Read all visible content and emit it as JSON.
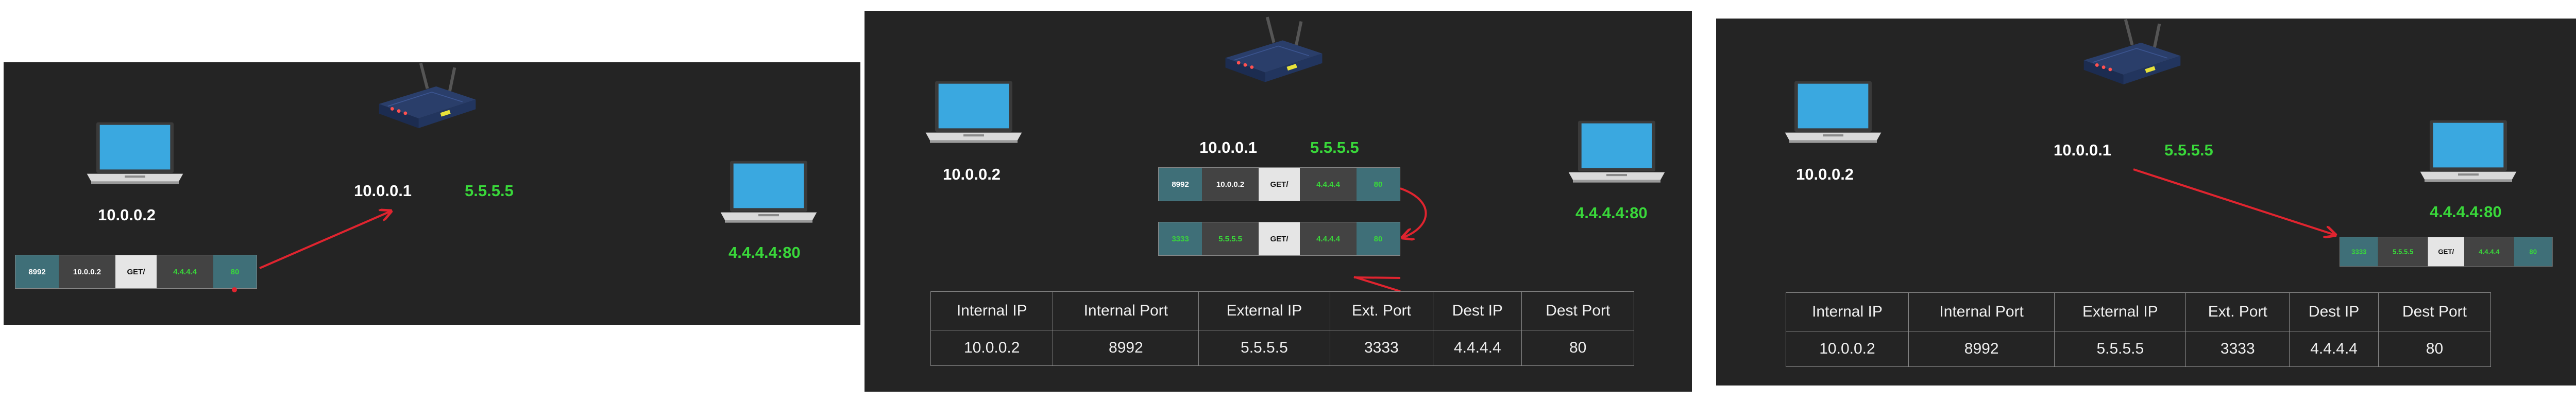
{
  "slides": [
    {
      "host_ip": "10.0.0.2",
      "router_private_ip": "10.0.0.1",
      "router_public_ip": "5.5.5.5",
      "server_addr": "4.4.4.4:80",
      "packet": {
        "src_port": "8992",
        "src_ip": "10.0.0.2",
        "payload": "GET/",
        "dst_ip": "4.4.4.4",
        "dst_port": "80"
      }
    },
    {
      "host_ip": "10.0.0.2",
      "router_private_ip": "10.0.0.1",
      "router_public_ip": "5.5.5.5",
      "server_addr": "4.4.4.4:80",
      "packet_in": {
        "src_port": "8992",
        "src_ip": "10.0.0.2",
        "payload": "GET/",
        "dst_ip": "4.4.4.4",
        "dst_port": "80"
      },
      "packet_out": {
        "src_port": "3333",
        "src_ip": "5.5.5.5",
        "payload": "GET/",
        "dst_ip": "4.4.4.4",
        "dst_port": "80"
      },
      "nat_table": {
        "headers": [
          "Internal IP",
          "Internal Port",
          "External IP",
          "Ext. Port",
          "Dest IP",
          "Dest Port"
        ],
        "row": [
          "10.0.0.2",
          "8992",
          "5.5.5.5",
          "3333",
          "4.4.4.4",
          "80"
        ]
      }
    },
    {
      "host_ip": "10.0.0.2",
      "router_private_ip": "10.0.0.1",
      "router_public_ip": "5.5.5.5",
      "server_addr": "4.4.4.4:80",
      "packet": {
        "src_port": "3333",
        "src_ip": "5.5.5.5",
        "payload": "GET/",
        "dst_ip": "4.4.4.4",
        "dst_port": "80"
      },
      "nat_table": {
        "headers": [
          "Internal IP",
          "Internal Port",
          "External IP",
          "Ext. Port",
          "Dest IP",
          "Dest Port"
        ],
        "row": [
          "10.0.0.2",
          "8992",
          "5.5.5.5",
          "3333",
          "4.4.4.4",
          "80"
        ]
      }
    }
  ],
  "colors": {
    "panel_bg": "#242424",
    "public_green": "#39d83a",
    "arrow_red": "#e0242f",
    "laptop_screen": "#3aa8e0"
  },
  "icons": [
    "laptop-icon",
    "router-icon"
  ]
}
